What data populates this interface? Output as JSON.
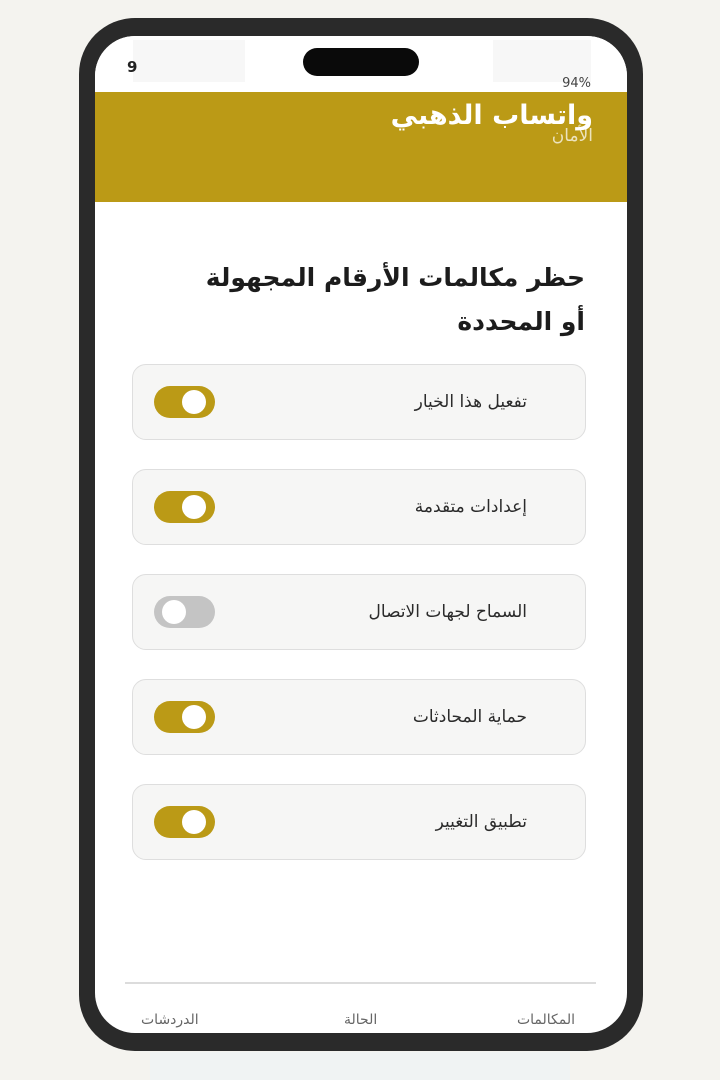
{
  "status": {
    "left": "9",
    "battery": "94%"
  },
  "header": {
    "title": "واتساب الذهبي",
    "subtitle": "الأمان"
  },
  "section": {
    "title": "حظر مكالمات الأرقام المجهولة أو المحددة"
  },
  "options": [
    {
      "label": "تفعيل هذا الخيار",
      "enabled": true
    },
    {
      "label": "إعدادات متقدمة",
      "enabled": true
    },
    {
      "label": "السماح لجهات الاتصال",
      "enabled": false
    },
    {
      "label": "حماية المحادثات",
      "enabled": true
    },
    {
      "label": "تطبيق التغيير",
      "enabled": true
    }
  ],
  "bottom_nav": {
    "calls": "المكالمات",
    "status": "الحالة",
    "chats": "الدردشات"
  },
  "colors": {
    "accent": "#bb9a16",
    "toggle_off": "#c4c4c4"
  }
}
